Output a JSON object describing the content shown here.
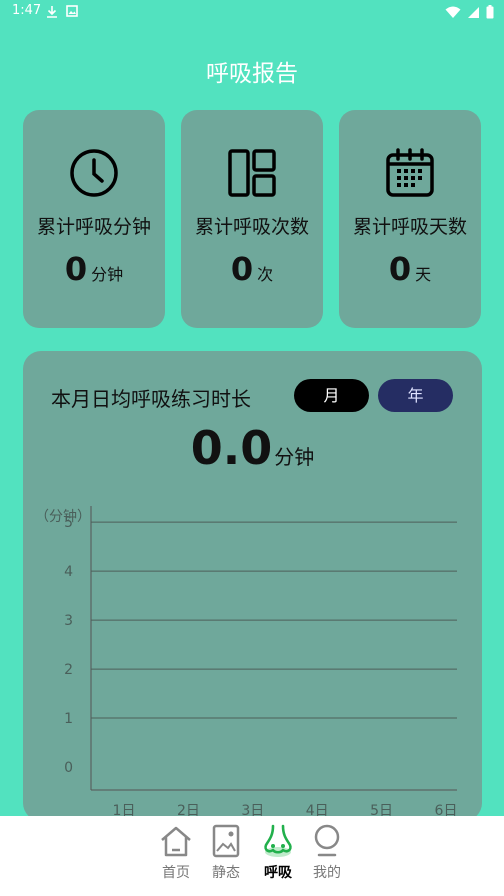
{
  "status_bar": {
    "time": "1:47",
    "icons_left": [
      "download-icon",
      "image-icon"
    ],
    "icons_right": [
      "wifi-icon",
      "signal-icon",
      "battery-icon"
    ]
  },
  "page": {
    "title": "呼吸报告"
  },
  "stats": [
    {
      "label": "累计呼吸分钟",
      "value": "0",
      "unit": "分钟",
      "icon": "clock-icon"
    },
    {
      "label": "累计呼吸次数",
      "value": "0",
      "unit": "次",
      "icon": "layout-icon"
    },
    {
      "label": "累计呼吸天数",
      "value": "0",
      "unit": "天",
      "icon": "calendar-icon"
    }
  ],
  "chart_card": {
    "title": "本月日均呼吸练习时长",
    "toggle_month": "月",
    "toggle_year": "年",
    "selected": "月",
    "avg_value": "0.0",
    "avg_unit": "分钟"
  },
  "chart_data": {
    "type": "line",
    "unit_label": "（分钟）",
    "categories": [
      "1日",
      "2日",
      "3日",
      "4日",
      "5日",
      "6日"
    ],
    "y_ticks": [
      "0",
      "1",
      "2",
      "3",
      "4",
      "5"
    ],
    "ylim": [
      0,
      5.8
    ],
    "grid": true,
    "series": [
      {
        "values": []
      }
    ]
  },
  "bottom_nav": [
    {
      "label": "首页",
      "icon": "home-icon",
      "active": false
    },
    {
      "label": "静态",
      "icon": "picture-icon",
      "active": false
    },
    {
      "label": "呼吸",
      "icon": "nose-icon",
      "active": true
    },
    {
      "label": "我的",
      "icon": "user-icon",
      "active": false
    }
  ],
  "colors": {
    "background": "#52E2BF",
    "card": "#6FA89B",
    "active_nav": "#22B04C",
    "year_toggle": "#252D63"
  }
}
